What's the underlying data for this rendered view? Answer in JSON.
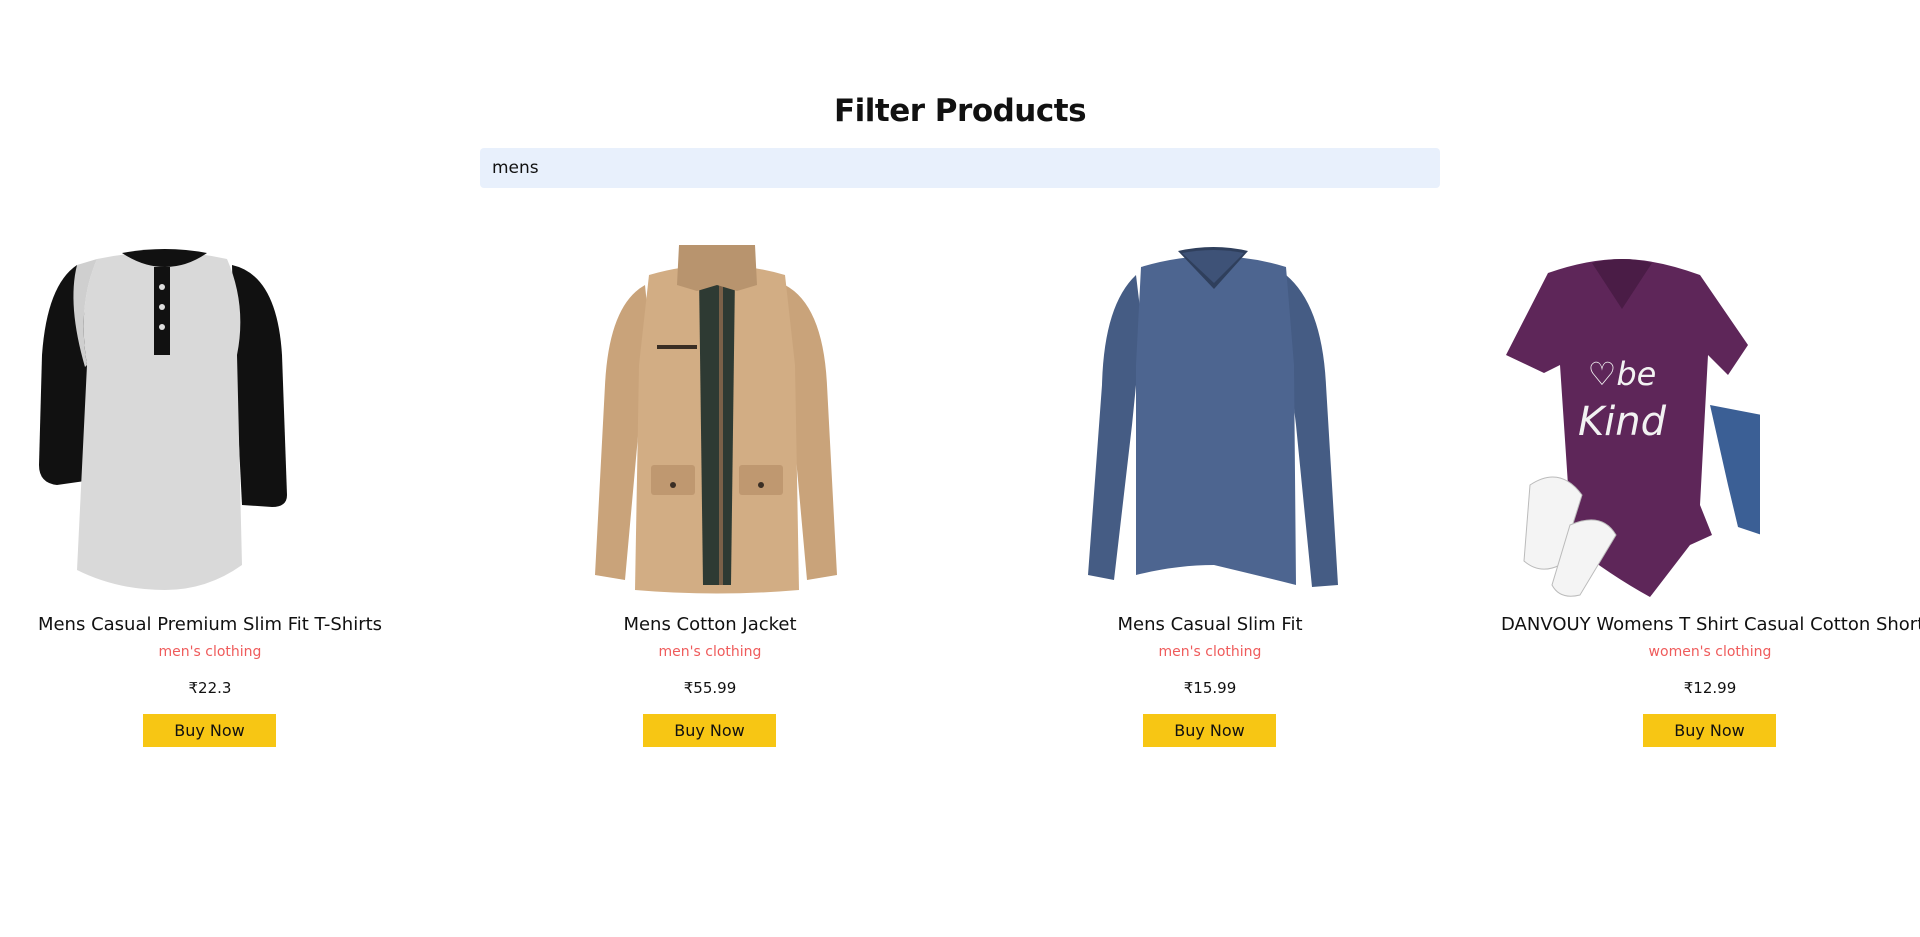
{
  "page": {
    "title": "Filter Products"
  },
  "search": {
    "value": "mens",
    "placeholder": ""
  },
  "products": [
    {
      "title": "Mens Casual Premium Slim Fit T-Shirts",
      "category": "men's clothing",
      "price": "₹22.3",
      "button": "Buy Now",
      "image": "raglan-henley-tshirt-grey-black"
    },
    {
      "title": "Mens Cotton Jacket",
      "category": "men's clothing",
      "price": "₹55.99",
      "button": "Buy Now",
      "image": "khaki-cotton-jacket"
    },
    {
      "title": "Mens Casual Slim Fit",
      "category": "men's clothing",
      "price": "₹15.99",
      "button": "Buy Now",
      "image": "blue-long-sleeve-vneck"
    },
    {
      "title": "DANVOUY Womens T Shirt Casual Cotton Short",
      "category": "women's clothing",
      "price": "₹12.99",
      "button": "Buy Now",
      "image": "purple-be-kind-tshirt",
      "image_text": "be kind"
    }
  ],
  "colors": {
    "search_bg": "#e8f0fc",
    "category": "#ef5b5b",
    "button": "#f7c614"
  }
}
